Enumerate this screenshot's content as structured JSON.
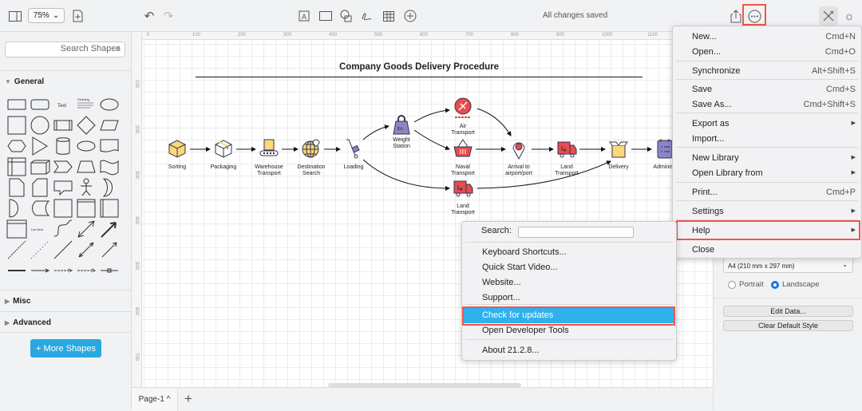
{
  "toolbar": {
    "zoom": "75%",
    "status": "All changes saved"
  },
  "sidebar": {
    "search_placeholder": "Search Shapes",
    "sections": [
      "General",
      "Misc",
      "Advanced"
    ],
    "more_shapes": "+ More Shapes",
    "shape_text_label": "Text",
    "shape_heading_label": "Heading",
    "shape_list_label": "List Item"
  },
  "diagram": {
    "title": "Company Goods Delivery Procedure",
    "nodes": [
      {
        "label": "Sorting",
        "icon": "box-sorting-icon"
      },
      {
        "label": "Packaging",
        "icon": "package-icon"
      },
      {
        "label": "Warehouse Transport",
        "icon": "conveyor-icon"
      },
      {
        "label": "Destination Search",
        "icon": "globe-pin-icon"
      },
      {
        "label": "Loading",
        "icon": "hand-truck-icon"
      },
      {
        "label": "Weight Station",
        "icon": "weight-icon"
      },
      {
        "label": "Air Transport",
        "icon": "airplane-icon"
      },
      {
        "label": "Naval Transport",
        "icon": "basket-icon"
      },
      {
        "label": "Land Transport",
        "icon": "truck-icon"
      },
      {
        "label": "Arrival to airport/port",
        "icon": "map-pin-icon"
      },
      {
        "label": "Land Transport",
        "icon": "truck-icon"
      },
      {
        "label": "Delivery",
        "icon": "open-box-icon"
      },
      {
        "label": "Administr",
        "icon": "clipboard-icon"
      }
    ],
    "weight_icon_text": "lbs.",
    "ruler_top": [
      "0",
      "100",
      "200",
      "300",
      "400",
      "500",
      "600",
      "700",
      "800",
      "900",
      "1000",
      "1100"
    ],
    "ruler_left": [
      "100",
      "200",
      "300",
      "400",
      "500",
      "600",
      "700"
    ]
  },
  "pages": {
    "tab": "Page-1 ^"
  },
  "format_panel": {
    "paper": "A4 (210 mm x 297 mm)",
    "portrait": "Portrait",
    "landscape": "Landscape",
    "orientation": "Landscape",
    "edit_data": "Edit Data...",
    "clear_style": "Clear Default Style"
  },
  "main_menu": [
    {
      "label": "New...",
      "shortcut": "Cmd+N"
    },
    {
      "label": "Open...",
      "shortcut": "Cmd+O"
    },
    {
      "label": "Synchronize",
      "shortcut": "Alt+Shift+S"
    },
    {
      "label": "Save",
      "shortcut": "Cmd+S"
    },
    {
      "label": "Save As...",
      "shortcut": "Cmd+Shift+S"
    },
    {
      "label": "Export as",
      "submenu": true
    },
    {
      "label": "Import..."
    },
    {
      "label": "New Library",
      "submenu": true
    },
    {
      "label": "Open Library from",
      "submenu": true
    },
    {
      "label": "Print...",
      "shortcut": "Cmd+P"
    },
    {
      "label": "Settings",
      "submenu": true
    },
    {
      "label": "Help",
      "submenu": true
    },
    {
      "label": "Close"
    }
  ],
  "help_menu": {
    "search_label": "Search:",
    "search_value": "",
    "items": [
      "Keyboard Shortcuts...",
      "Quick Start Video...",
      "Website...",
      "Support...",
      "Check for updates",
      "Open Developer Tools",
      "About 21.2.8..."
    ],
    "selected": "Check for updates"
  },
  "colors": {
    "highlight": "#f0564a",
    "selection": "#2fb1ee",
    "accent": "#29a8e0",
    "icon_yellow": "#fdd87b",
    "icon_red": "#e84c4c",
    "icon_purple": "#8a87c6"
  }
}
